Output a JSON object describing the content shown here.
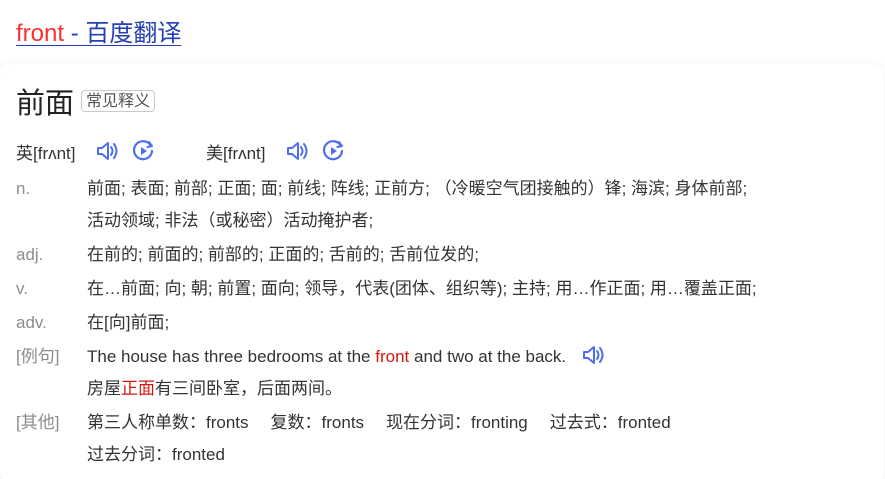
{
  "result_title": {
    "highlight": "front",
    "rest": " - 百度翻译"
  },
  "headword": "前面",
  "tag": "常见释义",
  "phonetics": {
    "uk": "英[frʌnt]",
    "us": "美[frʌnt]"
  },
  "definitions": [
    {
      "pos": "n.",
      "lines": [
        "前面; 表面; 前部; 正面; 面; 前线; 阵线; 正前方; （冷暖空气团接触的）锋; 海滨; 身体前部;",
        "活动领域; 非法（或秘密）活动掩护者;"
      ]
    },
    {
      "pos": "adj.",
      "lines": [
        "在前的; 前面的; 前部的; 正面的; 舌前的; 舌前位发的;"
      ]
    },
    {
      "pos": "v.",
      "lines": [
        "在…前面; 向; 朝; 前置; 面向; 领导，代表(团体、组织等); 主持; 用…作正面; 用…覆盖正面;"
      ]
    },
    {
      "pos": "adv.",
      "lines": [
        "在[向]前面;"
      ]
    }
  ],
  "example": {
    "label": "[例句]",
    "en_before": "The house has three bedrooms at the ",
    "en_highlight": "front",
    "en_after": " and two at the back.",
    "zh_before": "房屋",
    "zh_highlight": "正面",
    "zh_after": "有三间卧室，后面两间。"
  },
  "other": {
    "label": "[其他]",
    "forms": [
      "第三人称单数：fronts",
      "复数：fronts",
      "现在分词：fronting",
      "过去式：fronted"
    ],
    "form_line2": "过去分词：fronted"
  },
  "icons": {
    "speaker": "speaker-icon",
    "play": "play-circle-icon",
    "accent": "#4e6ef2"
  }
}
